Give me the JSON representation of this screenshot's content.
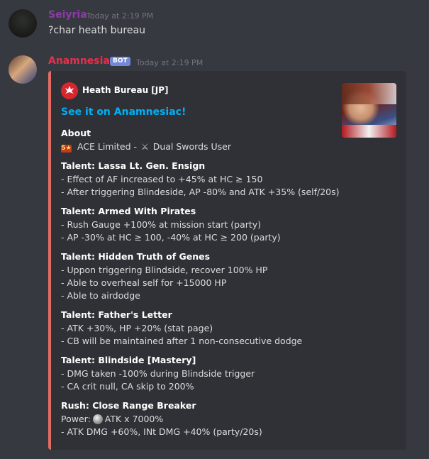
{
  "message1": {
    "username": "Seiyria",
    "timestamp": "Today at 2:19 PM",
    "content": "?char heath bureau"
  },
  "message2": {
    "username": "Anamnesiac",
    "bot_tag": "BOT",
    "timestamp": "Today at 2:19 PM"
  },
  "embed": {
    "accent_color": "#e06c63",
    "author": "Heath Bureau [JP]",
    "author_icon": "crest-icon",
    "title_link": "See it on Anamnesiac!",
    "about": {
      "heading": "About",
      "badge": "5★",
      "text_before": " ACE Limited - ",
      "weapon_icon": "dual-swords-icon",
      "text_after": " Dual Swords User"
    },
    "fields": [
      {
        "heading": "Talent: Lassa Lt. Gen. Ensign",
        "lines": [
          "- Effect of AF increased to +45% at HC ≥ 150",
          "- After triggering Blindeside, AP -80% and ATK +35% (self/20s)"
        ]
      },
      {
        "heading": "Talent: Armed With Pirates",
        "lines": [
          "- Rush Gauge +100% at mission start (party)",
          "- AP -30% at HC ≥ 100, -40% at HC ≥ 200 (party)"
        ]
      },
      {
        "heading": "Talent: Hidden Truth of Genes",
        "lines": [
          "- Uppon triggering Blindside, recover 100% HP",
          "- Able to overheal self for +15000 HP",
          "- Able to airdodge"
        ]
      },
      {
        "heading": "Talent: Father's Letter",
        "lines": [
          "- ATK +30%, HP +20% (stat page)",
          "- CB will be maintained after 1 non-consecutive dodge"
        ]
      },
      {
        "heading": "Talent: Blindside [Mastery]",
        "lines": [
          "- DMG taken -100% during Blindside trigger",
          "- CA crit null, CA skip to 200%"
        ]
      }
    ],
    "rush": {
      "heading": "Rush: Close Range Breaker",
      "power_label": "Power:",
      "power_icon": "orb-icon",
      "power_value": "ATK x 7000%",
      "line": "- ATK DMG +60%, INt DMG +40% (party/20s)"
    }
  }
}
